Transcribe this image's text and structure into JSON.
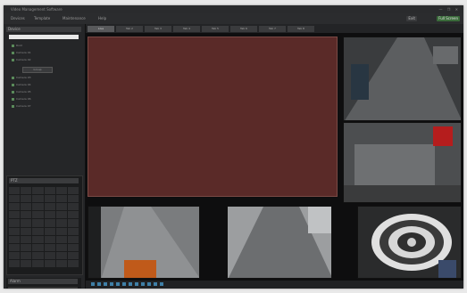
{
  "app": {
    "window_title": "Video Management Software",
    "window_controls": "— ❐ ✕"
  },
  "menu": {
    "items": [
      "Devices",
      "Template",
      "Maintenance",
      "Help"
    ],
    "right_items": [
      "Exit",
      "Full Screen"
    ]
  },
  "left_panel": {
    "device_tree_header": "Device",
    "search_placeholder": "",
    "tree_items": [
      "Root",
      "Camera 01",
      "Camera 02",
      "Camera 03",
      "Camera 04",
      "Camera 05",
      "Camera 06",
      "Camera 07"
    ],
    "sub_button": "Group",
    "ptz_header": "PTZ",
    "bottom_header": "Alarm"
  },
  "tabs": [
    "Live",
    "Tab 2",
    "Tab 3",
    "Tab 4",
    "Tab 5",
    "Tab 6",
    "Tab 7",
    "Tab 8"
  ],
  "video_tiles": [
    {
      "name": "camera-road-right-top"
    },
    {
      "name": "camera-street-right-middle"
    },
    {
      "name": "camera-parking-bottom-left"
    },
    {
      "name": "camera-road-bottom-center"
    },
    {
      "name": "camera-zebra-bottom-right"
    }
  ],
  "colors": {
    "window_bg": "#1e1f20",
    "selected_tile": "#5a2a28",
    "accent_green": "#3a6b3a",
    "accent_blue": "#3f7fa6"
  }
}
